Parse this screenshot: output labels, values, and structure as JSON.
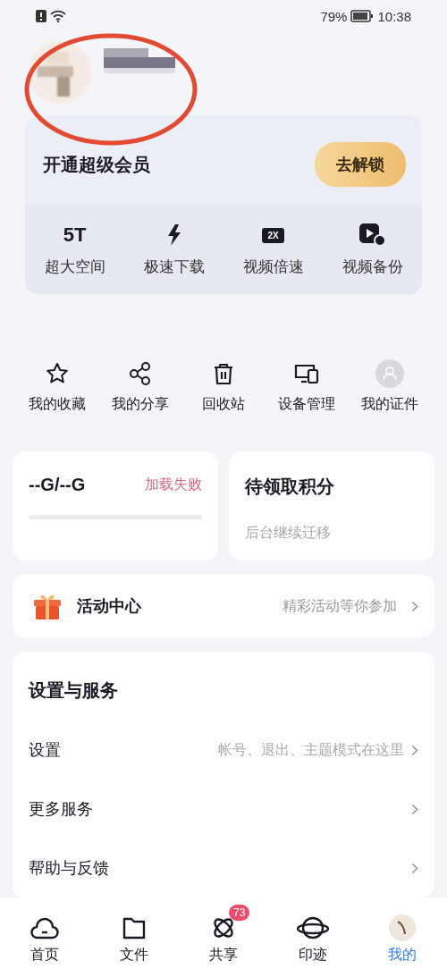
{
  "status_bar": {
    "battery_text": "79%",
    "time": "10:38"
  },
  "vip": {
    "title": "开通超级会员",
    "button": "去解锁",
    "perks": [
      {
        "kind": "text",
        "icon_text": "5T",
        "label": "超大空间"
      },
      {
        "kind": "bolt",
        "label": "极速下载"
      },
      {
        "kind": "speed",
        "icon_text": "2X",
        "label": "视频倍速"
      },
      {
        "kind": "video",
        "label": "视频备份"
      }
    ]
  },
  "shortcuts": [
    {
      "kind": "star",
      "label": "我的收藏"
    },
    {
      "kind": "share",
      "label": "我的分享"
    },
    {
      "kind": "trash",
      "label": "回收站"
    },
    {
      "kind": "devices",
      "label": "设备管理"
    },
    {
      "kind": "id",
      "label": "我的证件"
    }
  ],
  "storage": {
    "value": "--G/--G",
    "status": "加载失败",
    "level": 0
  },
  "points": {
    "title": "待领取积分",
    "subtitle": "后台继续迁移"
  },
  "activity": {
    "title": "活动中心",
    "hint": "精彩活动等你参加"
  },
  "settings": {
    "title": "设置与服务",
    "rows": [
      {
        "label": "设置",
        "hint": "帐号、退出、主题模式在这里"
      },
      {
        "label": "更多服务"
      },
      {
        "label": "帮助与反馈"
      }
    ]
  },
  "tab_bar": [
    {
      "kind": "home",
      "label": "首页",
      "selected": false
    },
    {
      "kind": "files",
      "label": "文件",
      "selected": false
    },
    {
      "kind": "share",
      "label": "共享",
      "selected": false,
      "badge": "73"
    },
    {
      "kind": "planet",
      "label": "印迹",
      "selected": false
    },
    {
      "kind": "avatar",
      "label": "我的",
      "selected": true
    }
  ]
}
